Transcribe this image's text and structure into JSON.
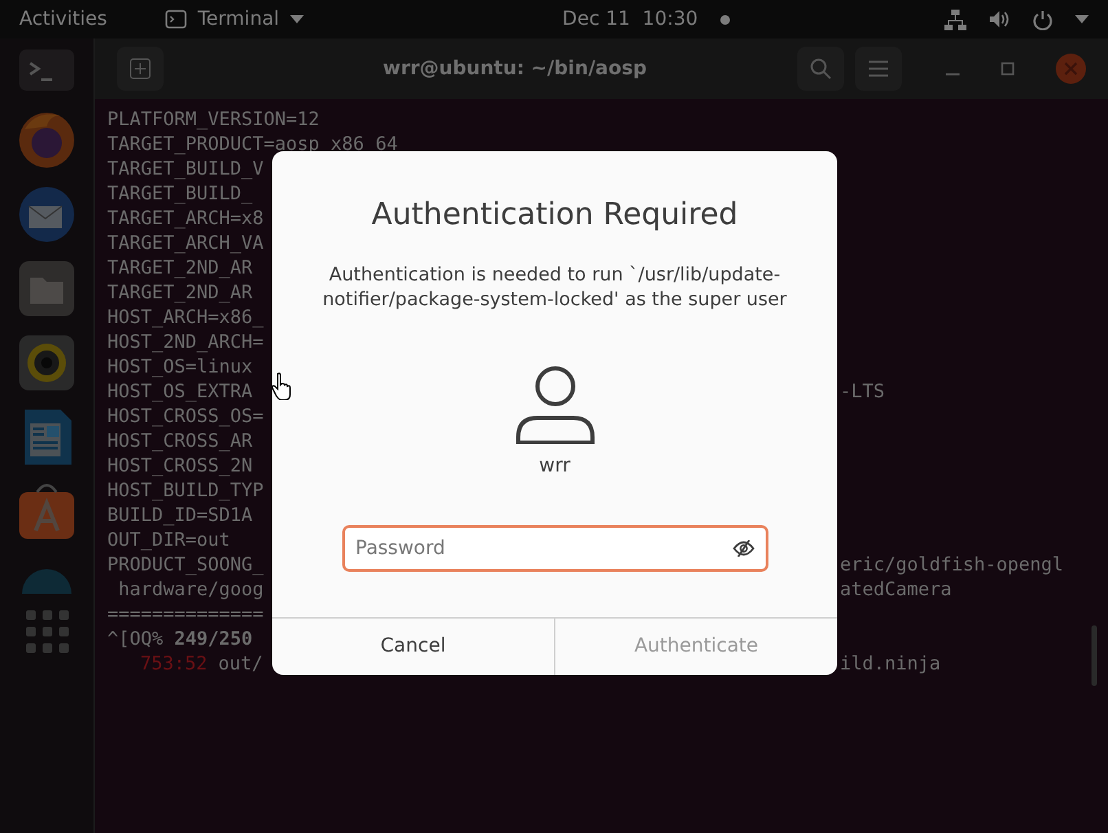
{
  "top_bar": {
    "activities": "Activities",
    "app_menu": "Terminal",
    "clock": "Dec 11  10:30"
  },
  "terminal": {
    "title": "wrr@ubuntu: ~/bin/aosp",
    "lines": [
      {
        "text": "PLATFORM_VERSION=12"
      },
      {
        "text": "TARGET_PRODUCT=aosp_x86_64"
      },
      {
        "text": "TARGET_BUILD_V"
      },
      {
        "text": "TARGET_BUILD_"
      },
      {
        "text": "TARGET_ARCH=x8"
      },
      {
        "text": "TARGET_ARCH_VA"
      },
      {
        "text": "TARGET_2ND_AR"
      },
      {
        "text": "TARGET_2ND_AR"
      },
      {
        "text": "HOST_ARCH=x86_"
      },
      {
        "text": "HOST_2ND_ARCH="
      },
      {
        "text": "HOST_OS=linux"
      },
      {
        "text": "HOST_OS_EXTRA",
        "right": "-LTS"
      },
      {
        "text": "HOST_CROSS_OS="
      },
      {
        "text": "HOST_CROSS_AR"
      },
      {
        "text": "HOST_CROSS_2N"
      },
      {
        "text": "HOST_BUILD_TYP"
      },
      {
        "text": "BUILD_ID=SD1A"
      },
      {
        "text": "OUT_DIR=out"
      },
      {
        "text": "PRODUCT_SOONG_",
        "right": "eric/goldfish-opengl"
      },
      {
        "text": " hardware/goog",
        "right": "atedCamera"
      },
      {
        "text": "=============="
      },
      {
        "text": "^[OQ% **249/250**"
      },
      {
        "time": "753:52",
        "text": "out/",
        "right": "ild.ninja"
      }
    ]
  },
  "dialog": {
    "title": "Authentication Required",
    "message": "Authentication is needed to run `/usr/lib/update-notifier/package-system-locked' as the super user",
    "user": "wrr",
    "password": {
      "placeholder": "Password",
      "focused": true
    },
    "buttons": [
      {
        "label": "Cancel",
        "disabled": false
      },
      {
        "label": "Authenticate",
        "disabled": true
      }
    ]
  }
}
